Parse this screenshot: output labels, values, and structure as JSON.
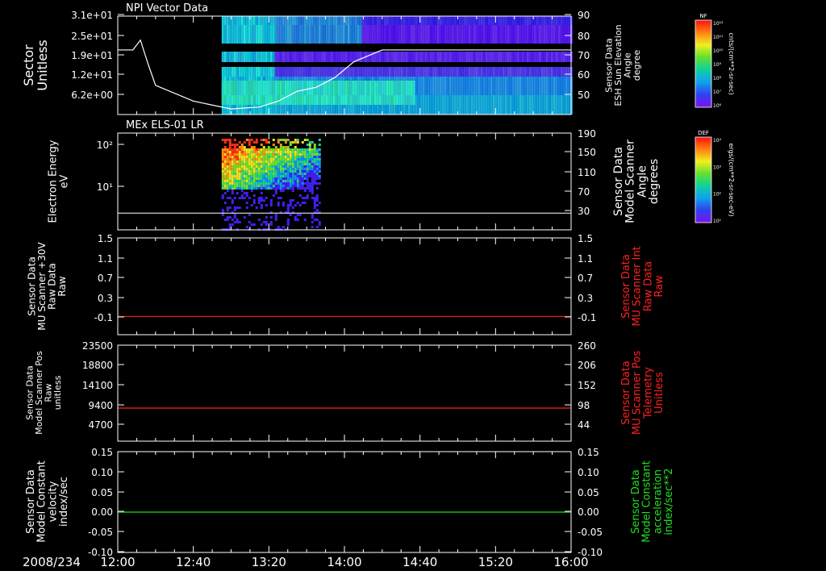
{
  "window": {
    "date_label": "2008/234",
    "time_ticks": [
      "12:00",
      "12:40",
      "13:20",
      "14:00",
      "14:40",
      "15:20",
      "16:00"
    ]
  },
  "colors": {
    "background": "#000000",
    "axis": "#ffffff",
    "red_trace": "#ff2020",
    "green_trace": "#20e020"
  },
  "colorbars": [
    {
      "title": "NF",
      "units": "cnts/(cm**2-sr-sec)",
      "ticks": [
        "10¹²",
        "10¹¹",
        "10¹⁰",
        "10⁹",
        "10⁸",
        "10⁷",
        "10⁶"
      ]
    },
    {
      "title": "DEF",
      "units": "ergs/(cm**2-sr-sec-eV)",
      "ticks": [
        "10⁴",
        "10³",
        "10²",
        "10¹"
      ]
    }
  ],
  "chart_data": [
    {
      "type": "heatmap",
      "title": "NPI Vector Data",
      "ylabel": [
        "Sector",
        "Unitless"
      ],
      "yticks": [
        "3.1e+01",
        "2.5e+01",
        "1.9e+01",
        "1.2e+01",
        "6.2e+00"
      ],
      "y2label": [
        "Sensor Data",
        "ESH Sun Elevation",
        "Angle",
        "degree"
      ],
      "y2ticks": [
        "90",
        "80",
        "70",
        "60",
        "50"
      ],
      "y2lim": [
        40,
        90
      ],
      "heatmap_time_range": [
        "12:55",
        "16:00"
      ],
      "overlay_line": {
        "axis": "right",
        "x_minutes": [
          0,
          8,
          12,
          16,
          20,
          40,
          60,
          75,
          85,
          95,
          105,
          115,
          125,
          140,
          180,
          240
        ],
        "y": [
          72,
          72,
          77,
          65,
          54,
          46,
          42,
          43,
          46,
          51,
          53,
          58,
          66,
          72,
          72,
          72
        ]
      }
    },
    {
      "type": "heatmap",
      "title": "MEx ELS-01 LR",
      "ylabel": [
        "Electron Energy",
        "eV"
      ],
      "yticks": [
        "10²",
        "10¹"
      ],
      "y2label": [
        "Sensor Data",
        "Model Scanner",
        "Angle",
        "degrees"
      ],
      "y2ticks": [
        "190",
        "150",
        "110",
        "70",
        "30"
      ],
      "y2lim": [
        -10,
        190
      ],
      "heatmap_time_range": [
        "12:55",
        "13:47"
      ],
      "overlay_line": {
        "axis": "right",
        "value": 3
      }
    },
    {
      "type": "line",
      "ylabel": [
        "Sensor Data",
        "MU Scanner +30V",
        "Raw Data",
        "Raw"
      ],
      "yticks": [
        "1.5",
        "1.1",
        "0.7",
        "0.3",
        "-0.1"
      ],
      "ylim": [
        -0.35,
        1.5
      ],
      "y2label": [
        "Sensor Data",
        "MU Scanner Int",
        "Raw Data",
        "Raw"
      ],
      "y2ticks": [
        "1.5",
        "1.1",
        "0.7",
        "0.3",
        "-0.1"
      ],
      "series": [
        {
          "value": 0.0,
          "color": "#ff2020"
        }
      ]
    },
    {
      "type": "line",
      "ylabel": [
        "Sensor Data",
        "Model Scanner Pos",
        "Raw",
        "unitless"
      ],
      "yticks": [
        "23500",
        "18800",
        "14100",
        "9400",
        "4700"
      ],
      "ylim": [
        0,
        23500
      ],
      "y2label": [
        "Sensor Data",
        "MU Scanner Pos",
        "Telemetry",
        "Unitless"
      ],
      "y2ticks": [
        "260",
        "206",
        "152",
        "98",
        "44"
      ],
      "series": [
        {
          "value": 8100,
          "color": "#ff2020"
        }
      ]
    },
    {
      "type": "line",
      "ylabel": [
        "Sensor Data",
        "Model Constant",
        "velocity",
        "index/sec"
      ],
      "yticks": [
        "0.15",
        "0.10",
        "0.05",
        "0.00",
        "-0.05",
        "-0.10"
      ],
      "ylim": [
        -0.1,
        0.15
      ],
      "y2label": [
        "Sensor Data",
        "Model Constant",
        "acceleration",
        "index/sec**2"
      ],
      "y2ticks": [
        "0.15",
        "0.10",
        "0.05",
        "0.00",
        "-0.05",
        "-0.10"
      ],
      "series": [
        {
          "value": 0.0,
          "color": "#20e020"
        }
      ]
    }
  ]
}
